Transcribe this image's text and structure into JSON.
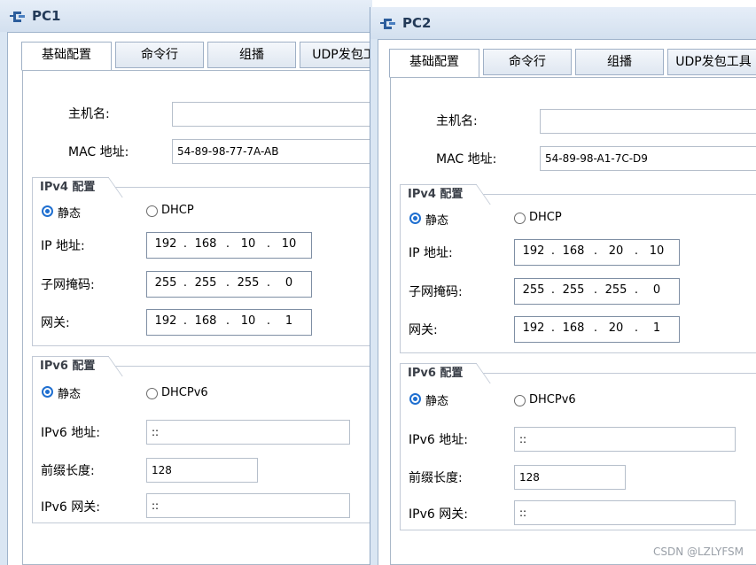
{
  "windows": [
    {
      "title": "PC1",
      "tabs": [
        "基础配置",
        "命令行",
        "组播",
        "UDP发包工"
      ],
      "hostname_label": "主机名:",
      "hostname_value": "",
      "mac_label": "MAC 地址:",
      "mac_value": "54-89-98-77-7A-AB",
      "ipv4_group_title": "IPv4 配置",
      "ipv4_static_label": "静态",
      "ipv4_dhcp_label": "DHCP",
      "ip_label": "IP 地址:",
      "ip": [
        "192",
        "168",
        "10",
        "10"
      ],
      "mask_label": "子网掩码:",
      "mask": [
        "255",
        "255",
        "255",
        "0"
      ],
      "gateway_label": "网关:",
      "gateway": [
        "192",
        "168",
        "10",
        "1"
      ],
      "ipv6_group_title": "IPv6 配置",
      "ipv6_static_label": "静态",
      "ipv6_dhcp_label": "DHCPv6",
      "ipv6_addr_label": "IPv6 地址:",
      "ipv6_addr_value": "::",
      "prefix_label": "前缀长度:",
      "prefix_value": "128",
      "ipv6_gw_label": "IPv6 网关:",
      "ipv6_gw_value": "::"
    },
    {
      "title": "PC2",
      "tabs": [
        "基础配置",
        "命令行",
        "组播",
        "UDP发包工具"
      ],
      "hostname_label": "主机名:",
      "hostname_value": "",
      "mac_label": "MAC 地址:",
      "mac_value": "54-89-98-A1-7C-D9",
      "ipv4_group_title": "IPv4 配置",
      "ipv4_static_label": "静态",
      "ipv4_dhcp_label": "DHCP",
      "ip_label": "IP 地址:",
      "ip": [
        "192",
        "168",
        "20",
        "10"
      ],
      "mask_label": "子网掩码:",
      "mask": [
        "255",
        "255",
        "255",
        "0"
      ],
      "gateway_label": "网关:",
      "gateway": [
        "192",
        "168",
        "20",
        "1"
      ],
      "ipv6_group_title": "IPv6 配置",
      "ipv6_static_label": "静态",
      "ipv6_dhcp_label": "DHCPv6",
      "ipv6_addr_label": "IPv6 地址:",
      "ipv6_addr_value": "::",
      "prefix_label": "前缀长度:",
      "prefix_value": "128",
      "ipv6_gw_label": "IPv6 网关:",
      "ipv6_gw_value": "::"
    }
  ],
  "watermark": "CSDN @LZLYFSM",
  "icons": {
    "app": "network-pc-icon"
  }
}
